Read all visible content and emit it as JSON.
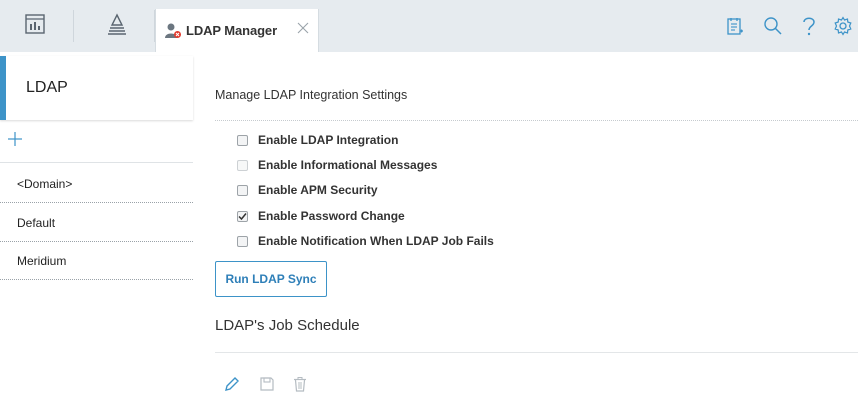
{
  "header": {
    "tab_label": "LDAP Manager",
    "icons": [
      "dashboard-icon",
      "asset-hierarchy-icon",
      "ldap-user-icon",
      "close-icon",
      "notes-icon",
      "search-icon",
      "help-icon",
      "settings-icon"
    ]
  },
  "sidebar": {
    "title": "LDAP",
    "add_label": "+",
    "items": [
      {
        "label": "<Domain>"
      },
      {
        "label": "Default"
      },
      {
        "label": "Meridium"
      }
    ]
  },
  "main": {
    "heading": "Manage LDAP Integration Settings",
    "options": [
      {
        "label": "Enable LDAP Integration",
        "checked": false,
        "disabled": false
      },
      {
        "label": "Enable Informational Messages",
        "checked": false,
        "disabled": true
      },
      {
        "label": "Enable APM Security",
        "checked": false,
        "disabled": false
      },
      {
        "label": "Enable Password Change",
        "checked": true,
        "disabled": false
      },
      {
        "label": "Enable Notification When LDAP Job Fails",
        "checked": false,
        "disabled": false
      }
    ],
    "run_sync_label": "Run LDAP Sync",
    "schedule_title": "LDAP's Job Schedule",
    "schedule_actions": [
      "edit-icon",
      "save-icon",
      "delete-icon"
    ]
  },
  "colors": {
    "accent": "#3d93c8",
    "topbar_bg": "#e6ebef",
    "link_blue": "#2e7fb8"
  }
}
